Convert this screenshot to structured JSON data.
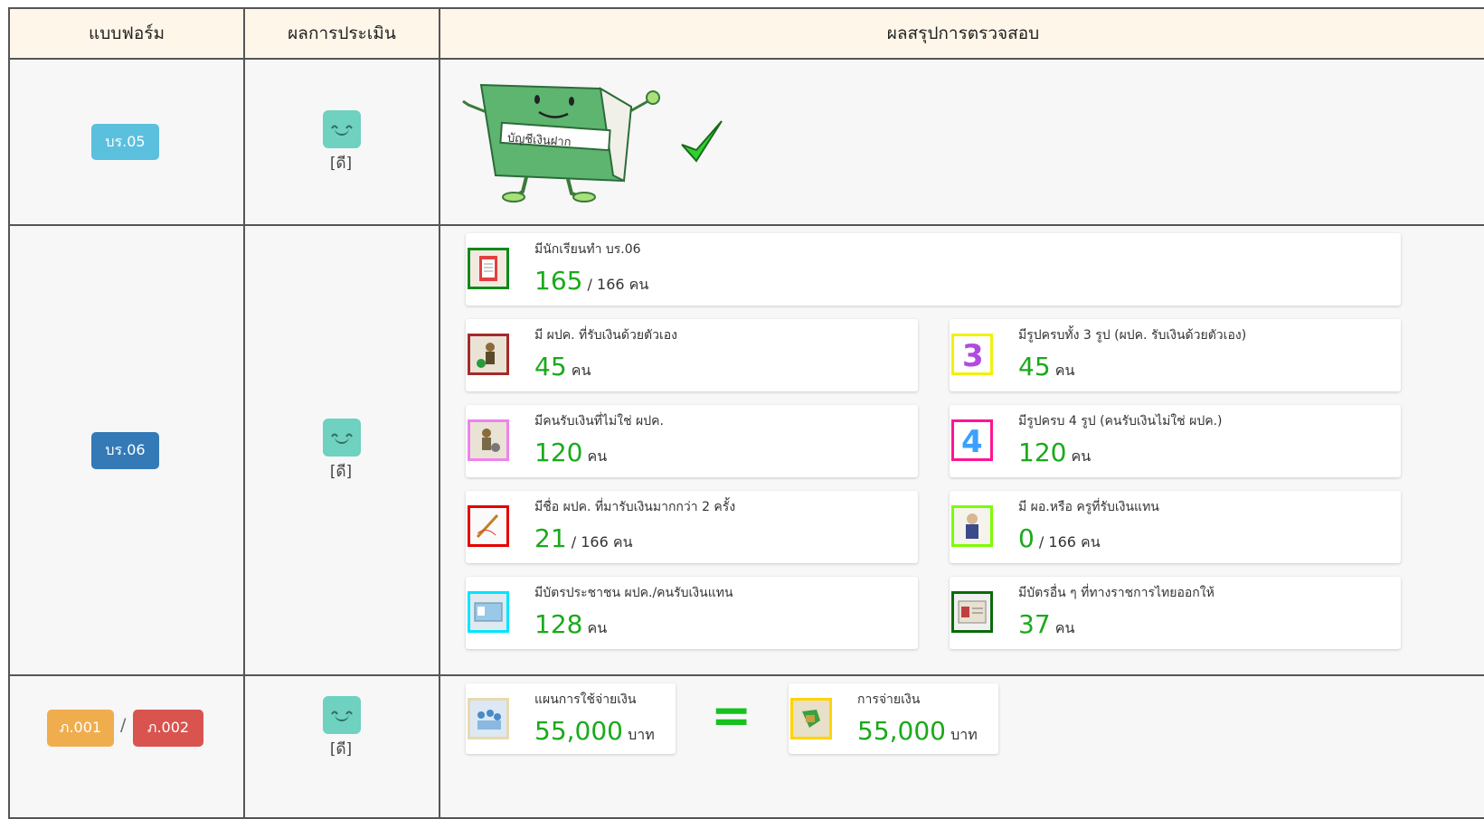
{
  "header": {
    "col_form": "แบบฟอร์ม",
    "col_eval": "ผลการประเมิน",
    "col_summary": "ผลสรุปการตรวจสอบ"
  },
  "rows": {
    "r1": {
      "badge": "บร.05",
      "badge_color": "#5bc0de",
      "eval_label": "[ดี]",
      "book_label": "บัญชีเงินฝาก"
    },
    "r2": {
      "badge": "บร.06",
      "badge_color": "#337ab7",
      "eval_label": "[ดี]",
      "cards": [
        {
          "title": "มีนักเรียนทำ บร.06",
          "num": "165",
          "sep": "/",
          "tot": "166",
          "unit": "คน",
          "icon": "clipboard-icon",
          "border": "#0a8a1a"
        },
        {
          "title": "มี ผปค. ที่รับเงินด้วยตัวเอง",
          "num": "45",
          "unit": "คน",
          "icon": "parent-money-icon",
          "border": "#a52a2a"
        },
        {
          "title": "มีรูปครบทั้ง 3 รูป (ผปค. รับเงินด้วยตัวเอง)",
          "num": "45",
          "unit": "คน",
          "icon": "number-3-icon",
          "border": "#f1f10a"
        },
        {
          "title": "มีคนรับเงินที่ไม่ใช่ ผปค.",
          "num": "120",
          "unit": "คน",
          "icon": "other-person-money-icon",
          "border": "#ee82ee"
        },
        {
          "title": "มีรูปครบ 4 รูป (คนรับเงินไม่ใช่ ผปค.)",
          "num": "120",
          "unit": "คน",
          "icon": "number-4-icon",
          "border": "#ff1493"
        },
        {
          "title": "มีชื่อ ผปค. ที่มารับเงินมากกว่า 2 ครั้ง",
          "num": "21",
          "sep": "/",
          "tot": "166",
          "unit": "คน",
          "icon": "signature-icon",
          "border": "#e60000"
        },
        {
          "title": "มี ผอ.หรือ ครูที่รับเงินแทน",
          "num": "0",
          "sep": "/",
          "tot": "166",
          "unit": "คน",
          "icon": "teacher-icon",
          "border": "#7cfc00"
        },
        {
          "title": "มีบัตรประชาชน ผปค./คนรับเงินแทน",
          "num": "128",
          "unit": "คน",
          "icon": "id-card-icon",
          "border": "#00e5ff"
        },
        {
          "title": "มีบัตรอื่น ๆ ที่ทางราชการไทยออกให้",
          "num": "37",
          "unit": "คน",
          "icon": "gov-card-icon",
          "border": "#0a6a0a"
        }
      ]
    },
    "r3": {
      "badge_a": "ภ.001",
      "badge_a_color": "#f0ad4e",
      "slash": "/",
      "badge_b": "ภ.002",
      "badge_b_color": "#d9534f",
      "eval_label": "[ดี]",
      "plan": {
        "title": "แผนการใช้จ่ายเงิน",
        "num": "55,000",
        "unit": "บาท",
        "icon": "plan-people-icon",
        "border": "#e8d9b0"
      },
      "equals": "=",
      "pay": {
        "title": "การจ่ายเงิน",
        "num": "55,000",
        "unit": "บาท",
        "icon": "money-hand-icon",
        "border": "#ffd400"
      }
    }
  }
}
